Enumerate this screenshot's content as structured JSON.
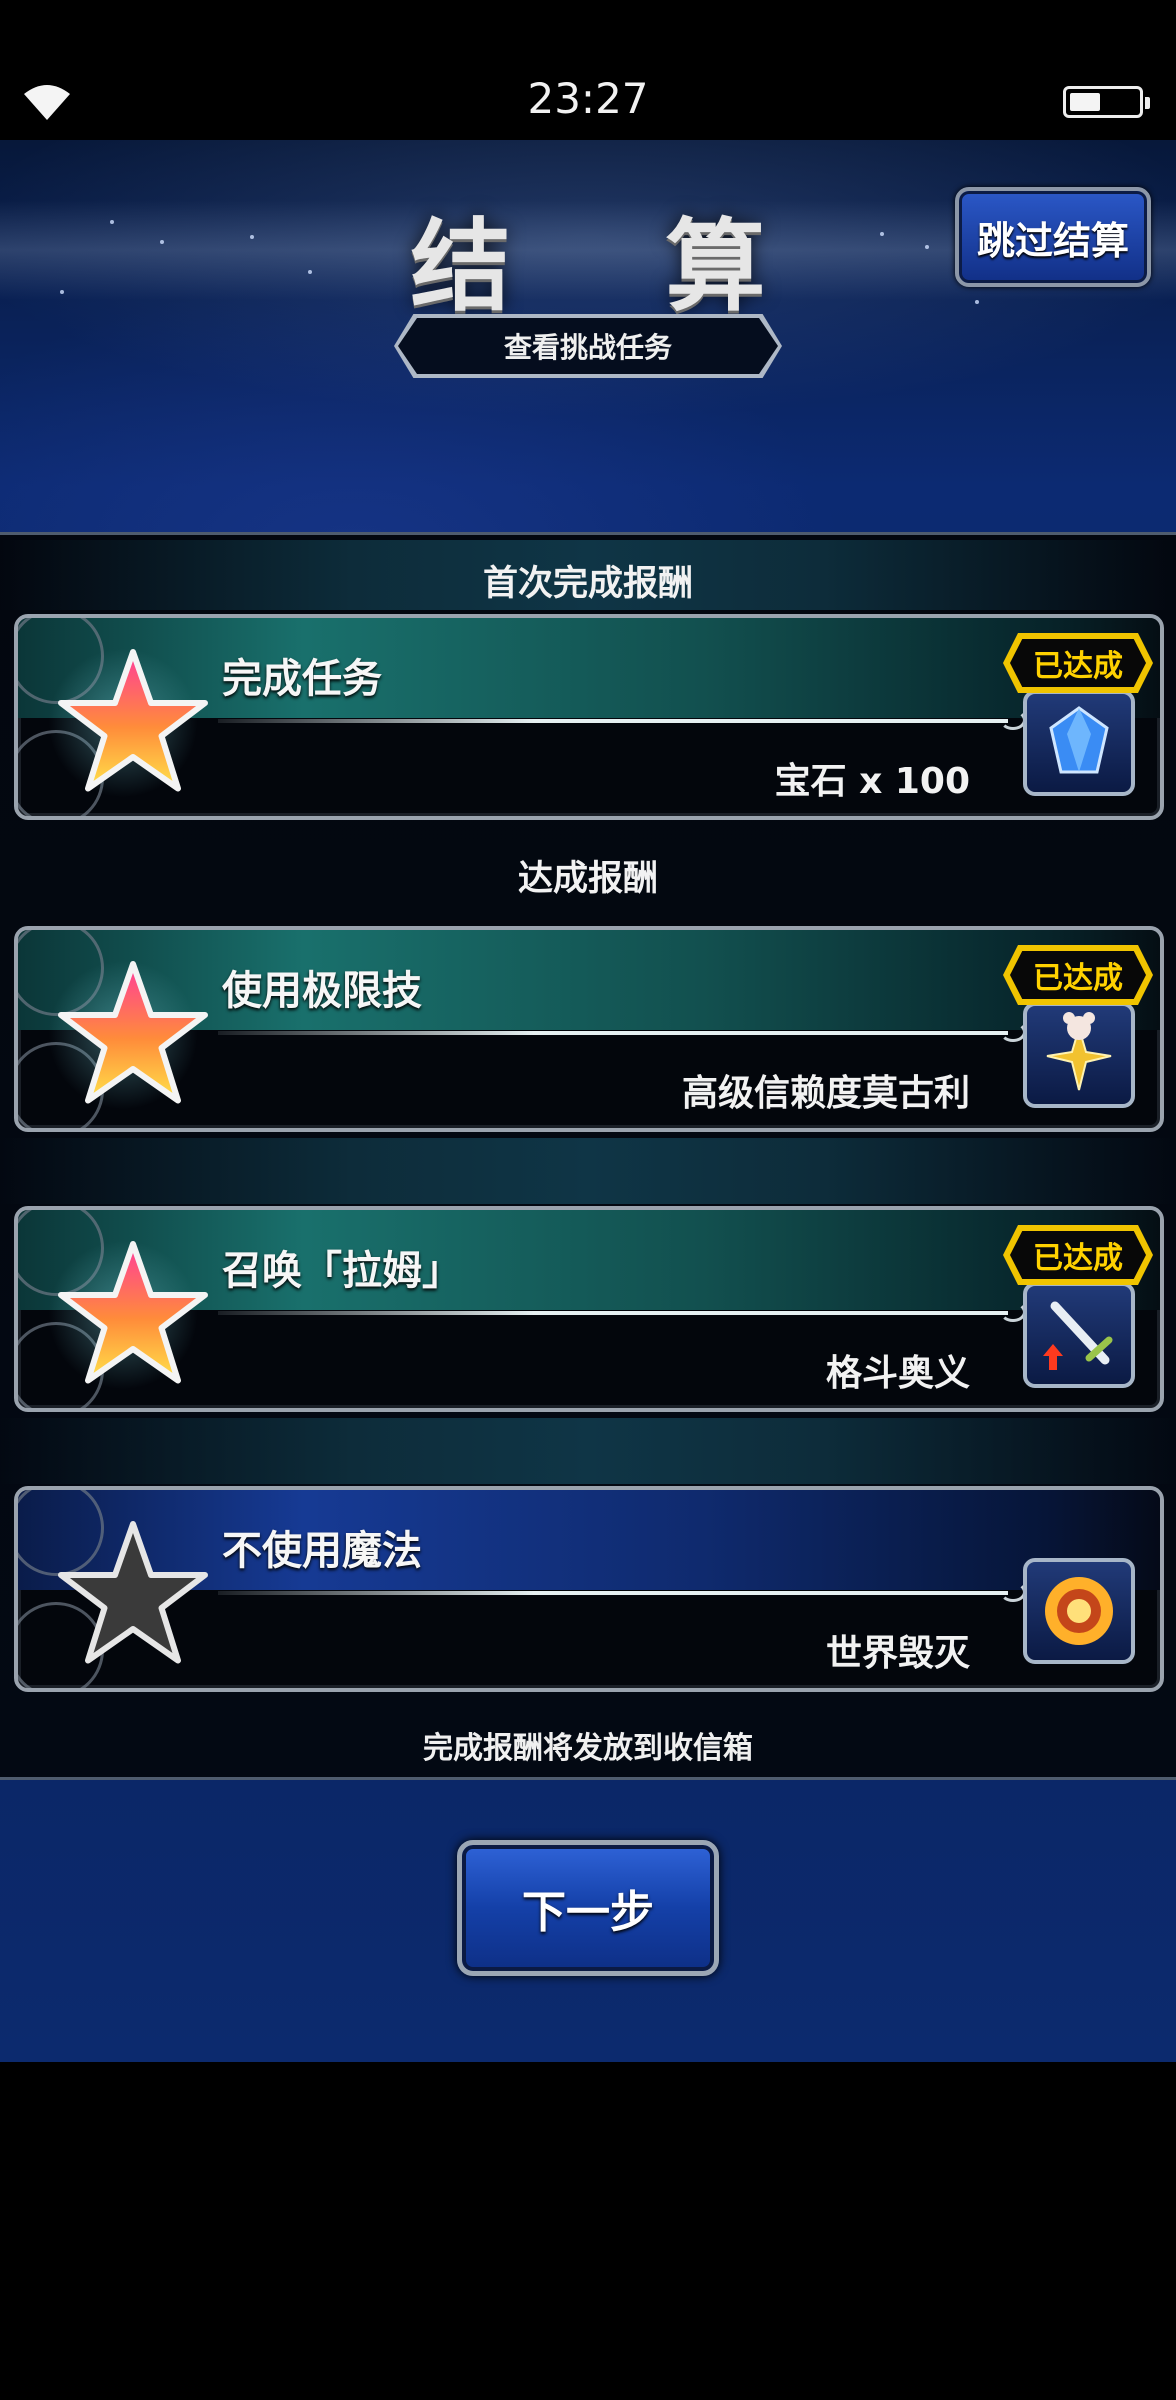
{
  "status_bar": {
    "time": "23:27",
    "wifi_icon": "wifi-icon",
    "battery_icon": "battery-icon"
  },
  "header": {
    "title": "结 算",
    "skip_label": "跳过结算",
    "view_challenge_label": "查看挑战任务"
  },
  "sections": {
    "first_clear": "首次完成报酬",
    "achievement": "达成报酬"
  },
  "missions": [
    {
      "name": "完成任务",
      "reward": "宝石 x 100",
      "status": "已达成",
      "achieved": true,
      "reward_icon": "crystal-gem-icon"
    },
    {
      "name": "使用极限技",
      "reward": "高级信赖度莫古利",
      "status": "已达成",
      "achieved": true,
      "reward_icon": "moogle-star-icon"
    },
    {
      "name": "召唤「拉姆」",
      "reward": "格斗奥义",
      "status": "已达成",
      "achieved": true,
      "reward_icon": "sword-upgrade-icon"
    },
    {
      "name": "不使用魔法",
      "reward": "世界毁灭",
      "status": "",
      "achieved": false,
      "reward_icon": "explosion-icon"
    }
  ],
  "footer_note": "完成报酬将发放到收信箱",
  "next_label": "下一步",
  "colors": {
    "achieved_badge": "#f0c400",
    "teal_header": "#19706c",
    "blue_header": "#163a94",
    "button_blue": "#1440a8"
  }
}
